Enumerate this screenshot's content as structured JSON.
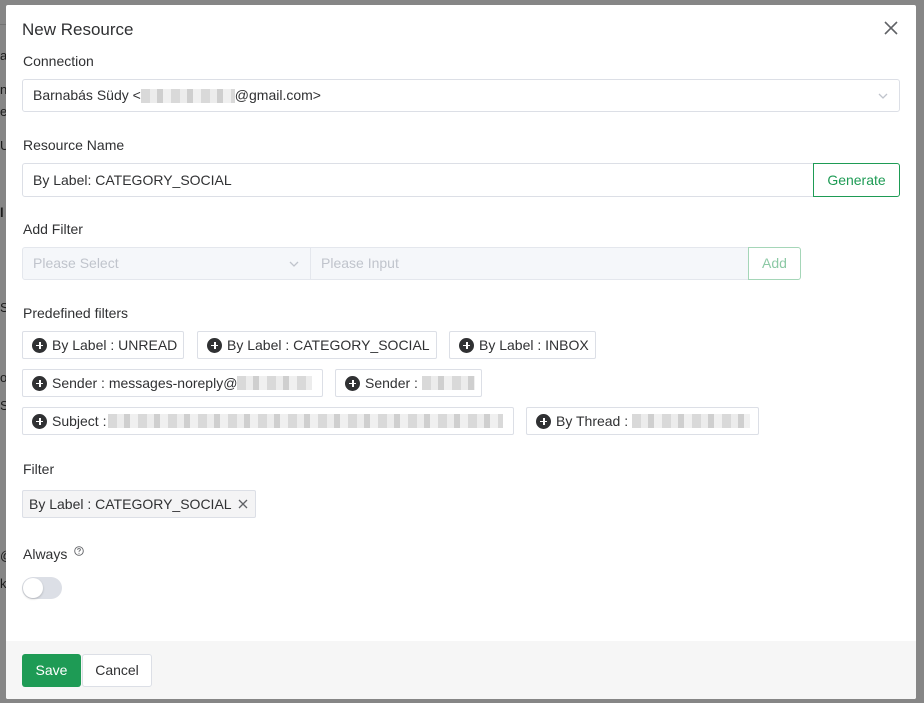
{
  "dialog": {
    "title": "New Resource",
    "connection_label": "Connection",
    "connection_name": "Barnabás Südy <",
    "connection_email_suffix": "@gmail.com>",
    "resource_name_label": "Resource Name",
    "resource_name_value": "By Label: CATEGORY_SOCIAL",
    "generate_label": "Generate",
    "add_filter_label": "Add Filter",
    "filter_select_placeholder": "Please Select",
    "filter_input_placeholder": "Please Input",
    "add_label": "Add",
    "predefined_label": "Predefined filters",
    "predefined": [
      {
        "text": "By Label : UNREAD"
      },
      {
        "text": "By Label : CATEGORY_SOCIAL"
      },
      {
        "text": "By Label : INBOX"
      },
      {
        "text": "Sender : messages-noreply@"
      },
      {
        "text": "Sender : "
      },
      {
        "text": "Subject : "
      },
      {
        "text": "By Thread : "
      }
    ],
    "filter_label": "Filter",
    "active_filter": "By Label : CATEGORY_SOCIAL",
    "always_label": "Always",
    "always_on": false,
    "save_label": "Save",
    "cancel_label": "Cancel"
  },
  "colors": {
    "primary": "#1e9b55",
    "text": "#303133",
    "border": "#dcdfe6"
  }
}
